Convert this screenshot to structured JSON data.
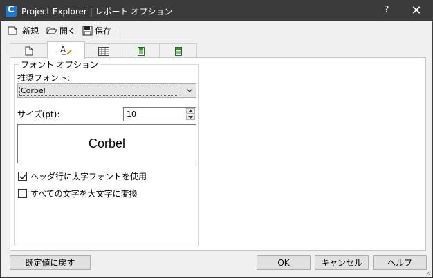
{
  "window": {
    "title": "Project Explorer | レポート オプション",
    "app_icon_letter": "C",
    "help_glyph": "?",
    "close_glyph": "✕"
  },
  "toolbar": {
    "new_label": "新規",
    "open_label": "開く",
    "save_label": "保存"
  },
  "tabs": [
    {
      "icon": "page-icon",
      "active": false
    },
    {
      "icon": "font-icon",
      "active": true
    },
    {
      "icon": "table-icon",
      "active": false
    },
    {
      "icon": "calculator-icon",
      "active": false
    },
    {
      "icon": "document-green-icon",
      "active": false
    }
  ],
  "font_options": {
    "group_title": "フォント オプション",
    "font_label": "推奨フォント:",
    "font_value": "Corbel",
    "size_label": "サイズ(pt):",
    "size_value": "10",
    "preview_text": "Corbel",
    "bold_header_label": "ヘッダ行に太字フォントを使用",
    "bold_header_checked": true,
    "uppercase_label": "すべての文字を大文字に変換",
    "uppercase_checked": false
  },
  "buttons": {
    "reset_label": "既定値に戻す",
    "ok_label": "OK",
    "cancel_label": "キャンセル",
    "help_label": "ヘルプ"
  }
}
